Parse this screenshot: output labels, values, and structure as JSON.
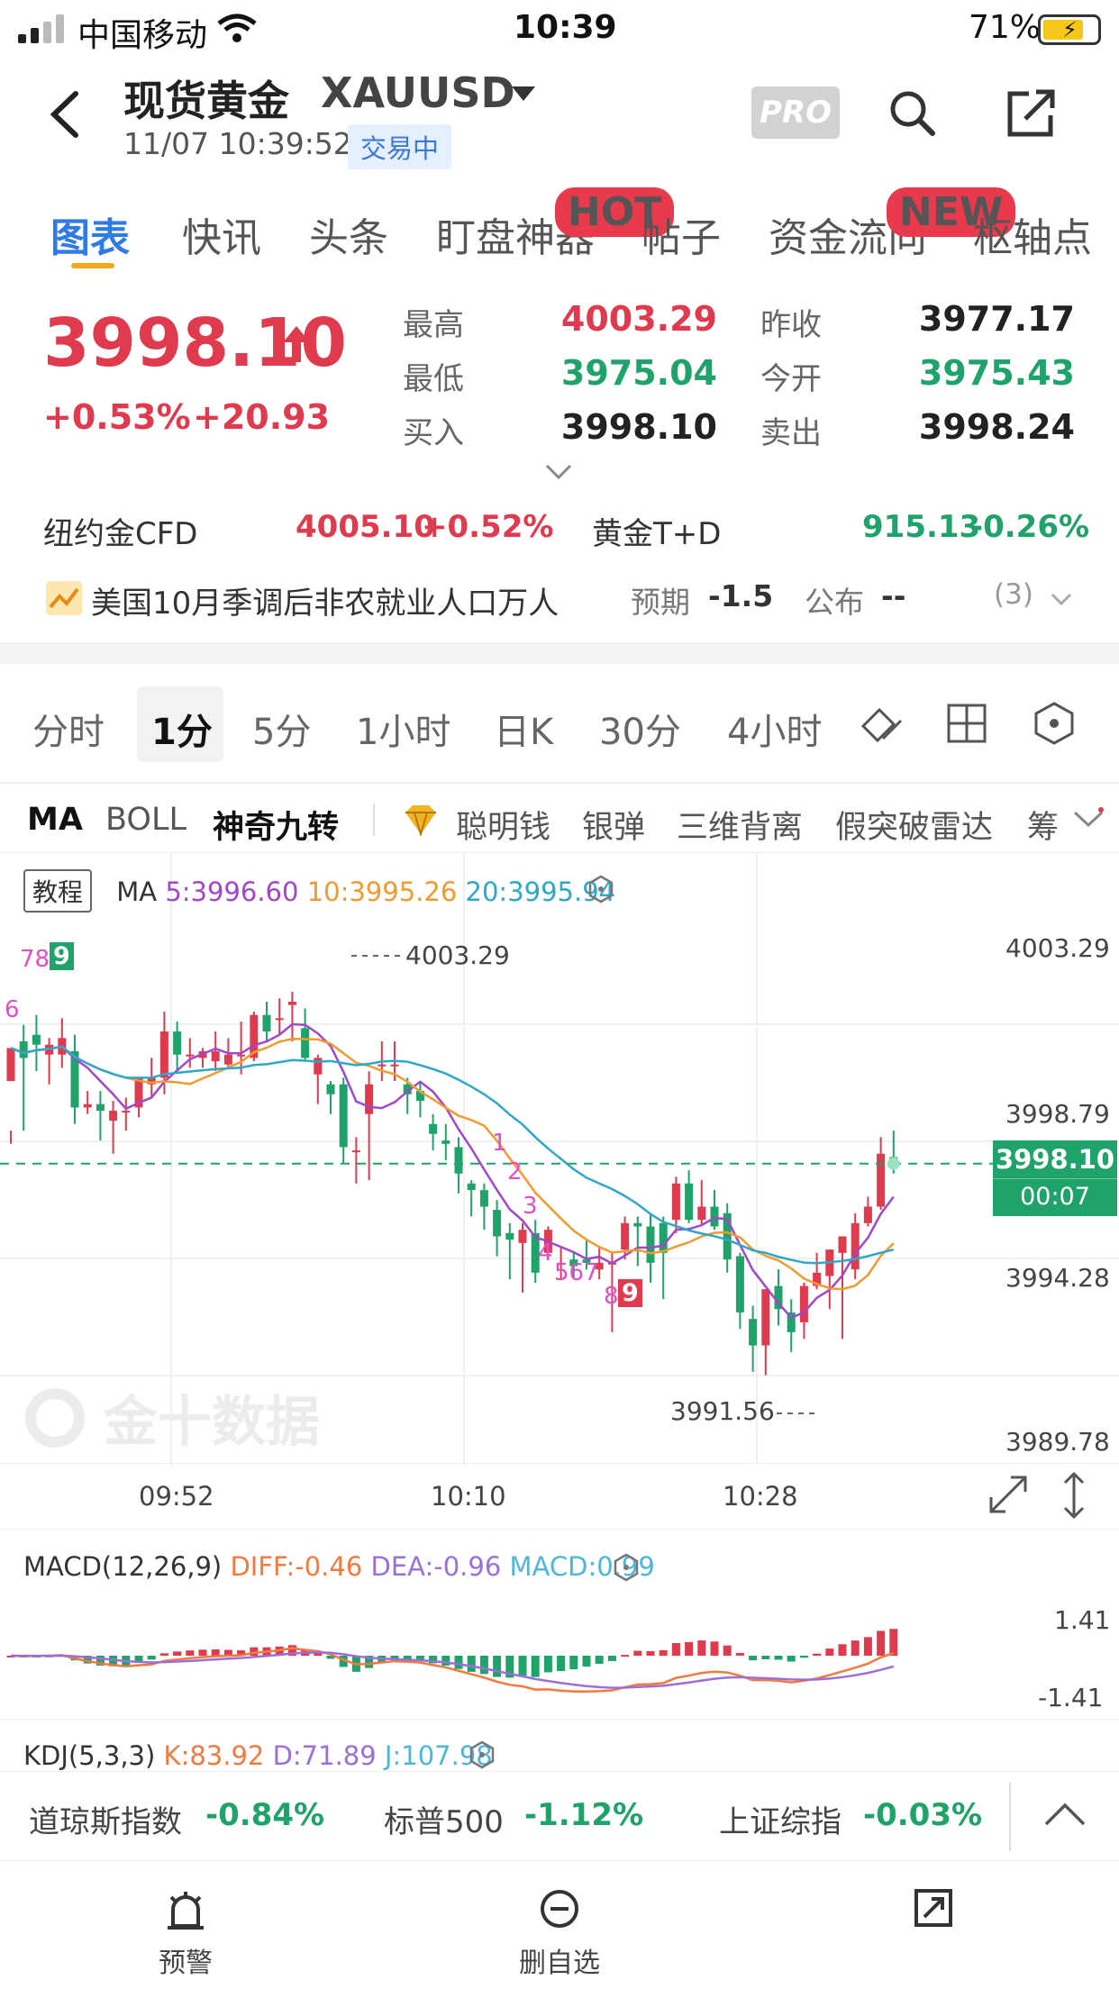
{
  "status_bar": {
    "carrier": "中国移动",
    "time": "10:39",
    "battery": "71%"
  },
  "header": {
    "title": "现货黄金",
    "symbol": "XAUUSD",
    "datetime": "11/07 10:39:52",
    "trade_status": "交易中",
    "pro_label": "PRO",
    "icons": [
      "back-icon",
      "dropdown-caret-icon",
      "search-icon",
      "share-icon"
    ]
  },
  "tabs": [
    {
      "label": "图表",
      "active": true
    },
    {
      "label": "快讯"
    },
    {
      "label": "头条"
    },
    {
      "label": "盯盘神器",
      "badge": "HOT"
    },
    {
      "label": "帖子"
    },
    {
      "label": "资金流向",
      "badge": "NEW"
    },
    {
      "label": "枢轴点"
    }
  ],
  "quote": {
    "price": "3998.10",
    "change_pct": "+0.53%",
    "change": "+20.93",
    "high_label": "最高",
    "high": "4003.29",
    "low_label": "最低",
    "low": "3975.04",
    "bid_label": "买入",
    "bid": "3998.10",
    "prev_close_label": "昨收",
    "prev_close": "3977.17",
    "open_label": "今开",
    "open": "3975.43",
    "ask_label": "卖出",
    "ask": "3998.24"
  },
  "related": {
    "cfd_name": "纽约金CFD",
    "cfd_price": "4005.10",
    "cfd_change": "+0.52%",
    "td_name": "黄金T+D",
    "td_price": "915.13",
    "td_change": "-0.26%"
  },
  "event": {
    "title": "美国10月季调后非农就业人口万人",
    "forecast_label": "预期",
    "forecast": "-1.5",
    "actual_label": "公布",
    "actual": "--",
    "count": "(3)"
  },
  "periods": [
    {
      "label": "分时"
    },
    {
      "label": "1分",
      "active": true
    },
    {
      "label": "5分"
    },
    {
      "label": "1小时"
    },
    {
      "label": "日K"
    },
    {
      "label": "30分"
    },
    {
      "label": "4小时"
    }
  ],
  "indicators": {
    "ma": "MA",
    "boll": "BOLL",
    "nine": "神奇九转",
    "tools": [
      "聪明钱",
      "银弹",
      "三维背离",
      "假突破雷达",
      "筹"
    ]
  },
  "main_chart": {
    "tutorial": "教程",
    "ma_label": "MA",
    "ma5": "5:3996.60",
    "ma10": "10:3995.26",
    "ma20": "20:3995.94",
    "ma5_color": "#a247c9",
    "ma10_color": "#f29a2e",
    "ma20_color": "#2ea8c9",
    "y_ticks": [
      "4003.29",
      "3998.79",
      "3994.28",
      "3989.78"
    ],
    "x_ticks": [
      "09:52",
      "10:10",
      "10:28"
    ],
    "high_mark": "4003.29",
    "low_mark": "3991.56",
    "current_price": "3998.10",
    "countdown": "00:07",
    "watermark": "金十数据",
    "nine_left": "789",
    "nine_left_9": "9",
    "nine_left_6": "6",
    "nine_seq": [
      "1",
      "2",
      "3",
      "4",
      "567",
      "8"
    ],
    "nine_final": "9"
  },
  "chart_data": {
    "type": "candlestick",
    "ylim": [
      3989.78,
      4004.5
    ],
    "up_color": "#e03a4e",
    "down_color": "#1fa36b",
    "candles": [
      [
        4000.6,
        4001.6,
        3999.1,
        3998.7
      ],
      [
        4001.8,
        4001.3,
        4002.3,
        3999.1
      ],
      [
        4002.0,
        4001.7,
        4002.6,
        4000.9
      ],
      [
        4001.4,
        4001.7,
        4001.9,
        4000.5
      ],
      [
        4001.4,
        4001.9,
        4002.5,
        4001.0
      ],
      [
        4001.5,
        3999.8,
        4002.0,
        3999.3
      ],
      [
        3999.8,
        3999.9,
        4000.3,
        3999.6
      ],
      [
        3999.9,
        3999.7,
        4000.3,
        3998.8
      ],
      [
        3999.4,
        3999.7,
        4000.0,
        3998.4
      ],
      [
        3999.7,
        3999.7,
        4000.1,
        3999.1
      ],
      [
        3999.8,
        4000.7,
        4000.7,
        3999.5
      ],
      [
        4000.5,
        4000.7,
        4001.3,
        4000.1
      ],
      [
        4000.7,
        4002.1,
        4002.7,
        4000.2
      ],
      [
        4002.1,
        4001.4,
        4002.4,
        4000.9
      ],
      [
        4001.4,
        4001.4,
        4001.9,
        4001.0
      ],
      [
        4001.3,
        4001.5,
        4001.6,
        4001.0
      ],
      [
        4001.2,
        4001.5,
        4002.1,
        4000.9
      ],
      [
        4001.1,
        4001.4,
        4001.9,
        4001.0
      ],
      [
        4001.4,
        4001.4,
        4002.4,
        4000.8
      ],
      [
        4001.3,
        4002.6,
        4002.7,
        4001.2
      ],
      [
        4002.6,
        4002.1,
        4003.0,
        4001.8
      ],
      [
        4002.5,
        4002.5,
        4003.1,
        4002.0
      ],
      [
        4002.9,
        4003.0,
        4003.3,
        4001.8
      ],
      [
        4002.2,
        4001.3,
        4002.8,
        4001.2
      ],
      [
        4000.8,
        4001.3,
        4001.4,
        3999.9
      ],
      [
        4000.5,
        4000.2,
        4000.6,
        3999.6
      ],
      [
        4000.5,
        3998.6,
        4000.7,
        3998.1
      ],
      [
        3998.5,
        3998.5,
        3998.9,
        3997.5
      ],
      [
        3999.6,
        4000.5,
        4000.9,
        3997.6
      ],
      [
        4001.1,
        4001.1,
        4001.8,
        4000.6
      ],
      [
        4001.1,
        4001.1,
        4001.8,
        4000.6
      ],
      [
        4000.5,
        4000.2,
        4000.7,
        3999.6
      ],
      [
        4000.3,
        4000.0,
        4000.6,
        3999.5
      ],
      [
        3999.3,
        3999.0,
        3999.6,
        3998.5
      ],
      [
        3998.8,
        3998.7,
        3999.3,
        3998.2
      ],
      [
        3998.6,
        3997.8,
        3998.9,
        3997.2
      ],
      [
        3997.5,
        3997.3,
        3997.6,
        3996.5
      ],
      [
        3997.3,
        3996.8,
        3997.5,
        3996.1
      ],
      [
        3996.7,
        3995.9,
        3997.0,
        3995.3
      ],
      [
        3996.0,
        3995.8,
        3996.3,
        3994.6
      ],
      [
        3995.7,
        3996.1,
        3996.3,
        3994.2
      ],
      [
        3996.0,
        3994.8,
        3996.4,
        3994.5
      ],
      [
        3995.4,
        3996.1,
        3996.2,
        3995.2
      ],
      [
        3995.1,
        3995.1,
        3995.6,
        3994.6
      ],
      [
        3995.2,
        3995.0,
        3995.4,
        3994.6
      ],
      [
        3995.2,
        3995.1,
        3995.8,
        3994.9
      ],
      [
        3994.9,
        3995.1,
        3995.6,
        3994.6
      ],
      [
        3995.1,
        3995.1,
        3995.4,
        3993.0
      ],
      [
        3995.5,
        3996.3,
        3996.5,
        3995.2
      ],
      [
        3996.3,
        3996.2,
        3996.5,
        3995.0
      ],
      [
        3996.2,
        3995.1,
        3996.6,
        3994.5
      ],
      [
        3996.3,
        3995.4,
        3996.5,
        3994.0
      ],
      [
        3996.4,
        3997.5,
        3997.7,
        3996.0
      ],
      [
        3997.5,
        3996.4,
        3997.9,
        3996.3
      ],
      [
        3996.4,
        3996.8,
        3997.6,
        3996.2
      ],
      [
        3996.8,
        3996.2,
        3997.3,
        3996.1
      ],
      [
        3996.6,
        3995.2,
        3996.9,
        3994.8
      ],
      [
        3995.3,
        3993.6,
        3995.4,
        3993.1
      ],
      [
        3993.4,
        3992.6,
        3993.8,
        3991.8
      ],
      [
        3992.6,
        3994.3,
        3994.3,
        3991.7
      ],
      [
        3994.4,
        3993.7,
        3994.9,
        3993.2
      ],
      [
        3993.6,
        3993.0,
        3994.0,
        3992.4
      ],
      [
        3993.3,
        3994.4,
        3994.5,
        3992.8
      ],
      [
        3994.4,
        3994.8,
        3995.4,
        3994.3
      ],
      [
        3994.7,
        3995.5,
        3995.5,
        3993.7
      ],
      [
        3995.4,
        3995.9,
        3995.9,
        3992.8
      ],
      [
        3994.9,
        3996.3,
        3996.6,
        3994.6
      ],
      [
        3996.3,
        3996.8,
        3997.1,
        3996.2
      ],
      [
        3996.8,
        3998.4,
        3998.9,
        3996.7
      ],
      [
        3998.3,
        3998.1,
        3999.1,
        3997.8
      ]
    ]
  },
  "macd": {
    "label": "MACD(12,26,9)",
    "diff": "DIFF:-0.46",
    "dea": "DEA:-0.96",
    "macd": "MACD:0.99",
    "diff_color": "#f27a3e",
    "dea_color": "#9b6fd8",
    "macd_color": "#4db7d9",
    "y_ticks": [
      "1.41",
      "-1.41"
    ]
  },
  "kdj": {
    "label": "KDJ(5,3,3)",
    "k": "K:83.92",
    "d": "D:71.89",
    "j": "J:107.98",
    "k_color": "#f27a3e",
    "d_color": "#9b6fd8",
    "j_color": "#4db7d9"
  },
  "indices": [
    {
      "name": "道琼斯指数",
      "change": "-0.84%"
    },
    {
      "name": "标普500",
      "change": "-1.12%"
    },
    {
      "name": "上证综指",
      "change": "-0.03%"
    }
  ],
  "bottom_nav": [
    {
      "label": "预警",
      "icon": "alarm-icon"
    },
    {
      "label": "删自选",
      "icon": "remove-favorite-icon"
    },
    {
      "label": "",
      "icon": "share-icon"
    }
  ]
}
